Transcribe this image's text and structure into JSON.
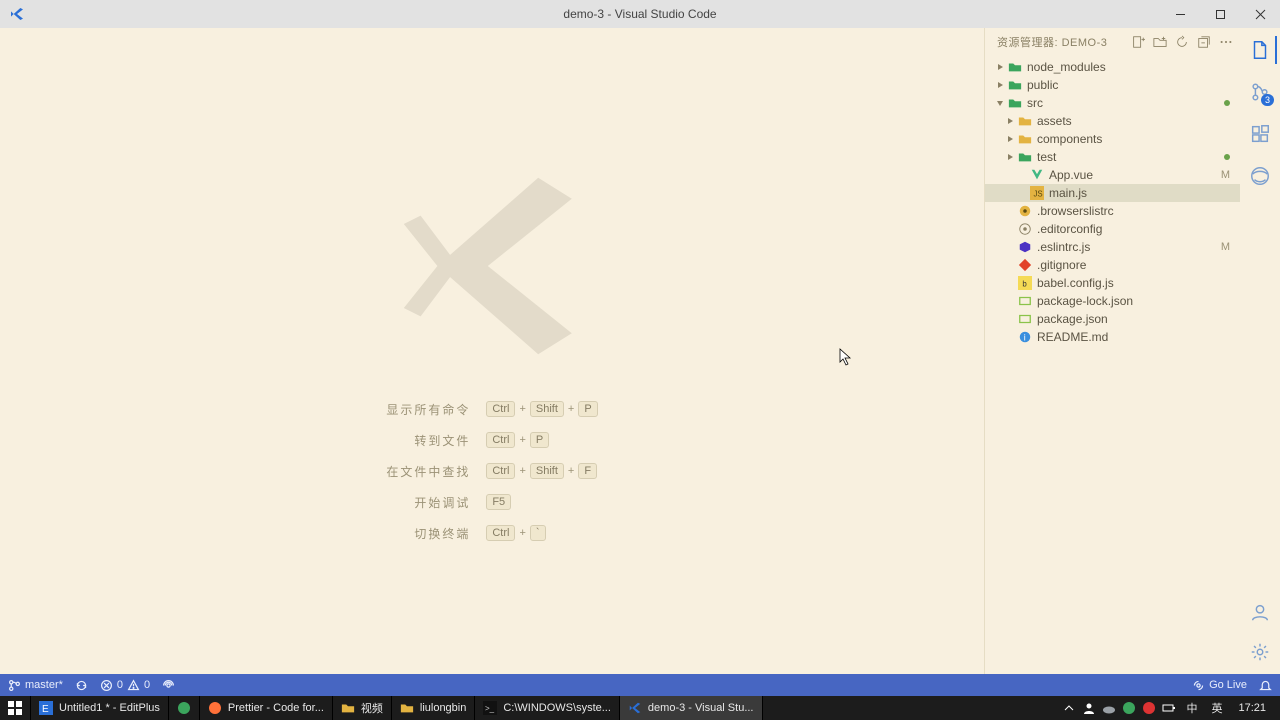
{
  "window": {
    "title": "demo-3 - Visual Studio Code"
  },
  "explorer": {
    "header": "资源管理器: DEMO-3",
    "tree": [
      {
        "name": "node_modules",
        "type": "folder",
        "indent": 0,
        "expanded": false,
        "color": "green"
      },
      {
        "name": "public",
        "type": "folder",
        "indent": 0,
        "expanded": false,
        "color": "green"
      },
      {
        "name": "src",
        "type": "folder",
        "indent": 0,
        "expanded": true,
        "color": "green",
        "badge_dot": true
      },
      {
        "name": "assets",
        "type": "folder",
        "indent": 1,
        "expanded": false
      },
      {
        "name": "components",
        "type": "folder",
        "indent": 1,
        "expanded": false
      },
      {
        "name": "test",
        "type": "folder",
        "indent": 1,
        "expanded": false,
        "color": "green",
        "badge_dot": true
      },
      {
        "name": "App.vue",
        "type": "file",
        "indent": 2,
        "icon": "vue",
        "badge": "M"
      },
      {
        "name": "main.js",
        "type": "file",
        "indent": 2,
        "icon": "js",
        "selected": true
      },
      {
        "name": ".browserslistrc",
        "type": "file",
        "indent": 1,
        "icon": "browsers"
      },
      {
        "name": ".editorconfig",
        "type": "file",
        "indent": 1,
        "icon": "editorconfig"
      },
      {
        "name": ".eslintrc.js",
        "type": "file",
        "indent": 1,
        "icon": "eslint",
        "badge": "M"
      },
      {
        "name": ".gitignore",
        "type": "file",
        "indent": 1,
        "icon": "git"
      },
      {
        "name": "babel.config.js",
        "type": "file",
        "indent": 1,
        "icon": "babel"
      },
      {
        "name": "package-lock.json",
        "type": "file",
        "indent": 1,
        "icon": "npm"
      },
      {
        "name": "package.json",
        "type": "file",
        "indent": 1,
        "icon": "npm"
      },
      {
        "name": "README.md",
        "type": "file",
        "indent": 1,
        "icon": "info"
      }
    ]
  },
  "welcome": {
    "shortcuts": [
      {
        "label": "显示所有命令",
        "keys": [
          "Ctrl",
          "Shift",
          "P"
        ]
      },
      {
        "label": "转到文件",
        "keys": [
          "Ctrl",
          "P"
        ]
      },
      {
        "label": "在文件中查找",
        "keys": [
          "Ctrl",
          "Shift",
          "F"
        ]
      },
      {
        "label": "开始调试",
        "keys": [
          "F5"
        ]
      },
      {
        "label": "切换终端",
        "keys": [
          "Ctrl",
          "`"
        ]
      }
    ]
  },
  "activity": {
    "scm_badge": "3"
  },
  "statusbar": {
    "branch": "master*",
    "errors": "0",
    "warnings": "0",
    "golive": "Go Live"
  },
  "taskbar": {
    "items": [
      {
        "label": "Untitled1 * - EditPlus",
        "icon": "editplus"
      },
      {
        "label": "",
        "icon": "generic"
      },
      {
        "label": "Prettier - Code for...",
        "icon": "firefox"
      },
      {
        "label": "视频",
        "icon": "folder"
      },
      {
        "label": "liulongbin",
        "icon": "folder"
      },
      {
        "label": "C:\\WINDOWS\\syste...",
        "icon": "cmd"
      },
      {
        "label": "demo-3 - Visual Stu...",
        "icon": "vscode",
        "active": true
      }
    ],
    "lang1": "中",
    "lang2": "英",
    "clock": "17:21"
  }
}
